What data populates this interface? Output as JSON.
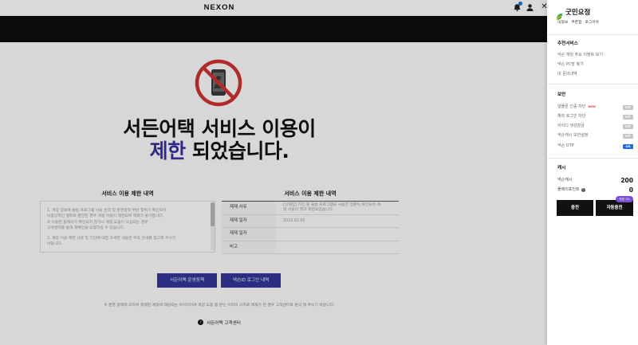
{
  "header": {
    "logo": "NEXON",
    "icons": [
      "notification-bell-icon",
      "user-icon",
      "close-icon"
    ],
    "badge_color": "#1e6fe8"
  },
  "restriction": {
    "icon": "prohibited-phone-icon",
    "icon_color": "#cf3232",
    "title_line1": "서든어택 서비스 이용이",
    "title_highlight": "제한",
    "title_line2_rest": " 되었습니다.",
    "highlight_color": "#3b2f9e"
  },
  "notice": {
    "title": "서비스 이용 제한 내역",
    "lines": [
      "1. 계정 정보에 불법 프로그램 사용 흔적 및 운영정책 위반 행위가 확인되어",
      "   비정상적인 행위로 판단된 경우 계정 이용이 제한되며 해제가 불가합니다.",
      "   ※ 이용된 플레이가 확인되지 않거나 계정 도용이 의심되는 경우",
      "      고객센터를 통해 재확인을 요청하실 수 있습니다.",
      "2. 계정 이용 제한 사유 및 기간에 대한 자세한 내용은 우측 안내를 참고해 주시기",
      "   바랍니다."
    ]
  },
  "detail": {
    "title": "서비스 이용 제한 내역",
    "rows": [
      {
        "label": "제재 사유",
        "value_line1": "[인게임] 기간 중 불법 프로그램을 사용한 정황이 확인되어 계",
        "value_line2": "정 이용이 영구 제한되었습니다."
      },
      {
        "label": "제재 일자",
        "value": "2022.01.05"
      },
      {
        "label": "제재 일자",
        "value": ""
      },
      {
        "label": "비고",
        "value": ""
      }
    ]
  },
  "actions": {
    "policy_button": "서든어택 운영정책",
    "login_history_button": "넥슨ID 로그인 내역",
    "button_color": "#33379a"
  },
  "footer": {
    "note": "※ 운영 정책에 의하여 제재된 계정에 해당되는 아이디이며 계정 도용 등 본인 이외의 사유로 제재가 된 경우 고객센터로 문의 해 주시기 바랍니다.",
    "support_link": "서든어택 고객센터",
    "support_icon": "help-circle-icon"
  },
  "panel": {
    "profile": {
      "name": "굿민요정",
      "links": [
        "내정보",
        "쿠폰함",
        "로그아웃"
      ]
    },
    "recommended": {
      "title": "추천서비스",
      "items": [
        "넥슨 게임 주요 이벤트 보기",
        "넥슨 PC방 찾기",
        "내 문의내역"
      ]
    },
    "security": {
      "title": "보안",
      "items": [
        {
          "label": "알뜰폰 인증 차단",
          "badge": "NEW",
          "state": "OFF"
        },
        {
          "label": "해외 로그인 차단",
          "state": "OFF"
        },
        {
          "label": "아이디 생성잠금",
          "state": "OFF"
        },
        {
          "label": "넥슨캐시 보안설정",
          "state": "OFF"
        },
        {
          "label": "넥슨 OTP",
          "state": "ON"
        }
      ],
      "off_color": "#c4c4c4",
      "on_color": "#1b6ef3"
    },
    "cash": {
      "title": "캐시",
      "rows": [
        {
          "label": "넥슨캐시",
          "value": "200"
        },
        {
          "label": "플레이포인트",
          "value": "0"
        }
      ],
      "charge_button": "충전",
      "auto_charge_button": "자동충전",
      "auto_charge_badge": "적립 1%",
      "badge_color": "#7b4fd6"
    }
  }
}
